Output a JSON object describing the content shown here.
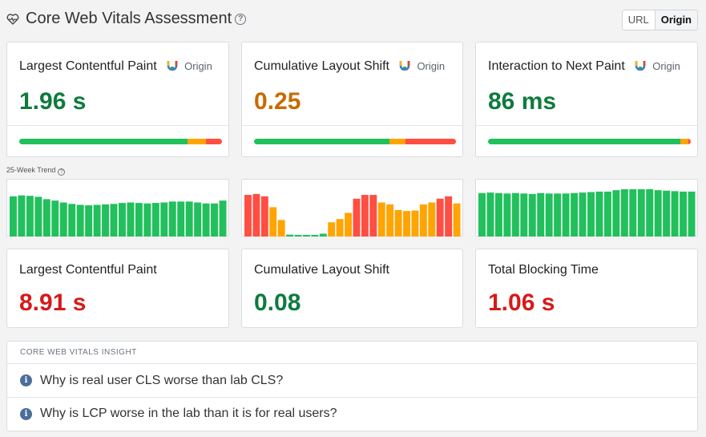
{
  "header": {
    "title": "Core Web Vitals Assessment",
    "toggle": {
      "url": "URL",
      "origin": "Origin",
      "active": "origin"
    }
  },
  "field_cards": [
    {
      "title": "Largest Contentful Paint",
      "badge": "Origin",
      "value": "1.96 s",
      "status": "good",
      "distribution": {
        "good": 0.83,
        "ni": 0.09,
        "poor": 0.08
      }
    },
    {
      "title": "Cumulative Layout Shift",
      "badge": "Origin",
      "value": "0.25",
      "status": "ni",
      "distribution": {
        "good": 0.67,
        "ni": 0.08,
        "poor": 0.25
      }
    },
    {
      "title": "Interaction to Next Paint",
      "badge": "Origin",
      "value": "86 ms",
      "status": "good",
      "distribution": {
        "good": 0.95,
        "ni": 0.04,
        "poor": 0.01
      }
    }
  ],
  "trend": {
    "label": "25-Week Trend",
    "series": [
      {
        "name": "",
        "values": [
          0.85,
          0.87,
          0.86,
          0.84,
          0.79,
          0.76,
          0.72,
          0.69,
          0.67,
          0.66,
          0.67,
          0.68,
          0.69,
          0.71,
          0.72,
          0.71,
          0.7,
          0.71,
          0.72,
          0.74,
          0.74,
          0.74,
          0.72,
          0.7,
          0.7,
          0.76
        ],
        "colors": [
          "good",
          "good",
          "good",
          "good",
          "good",
          "good",
          "good",
          "good",
          "good",
          "good",
          "good",
          "good",
          "good",
          "good",
          "good",
          "good",
          "good",
          "good",
          "good",
          "good",
          "good",
          "good",
          "good",
          "good",
          "good",
          "good"
        ]
      },
      {
        "name": "",
        "values": [
          0.88,
          0.9,
          0.85,
          0.62,
          0.35,
          0.04,
          0.03,
          0.03,
          0.03,
          0.06,
          0.3,
          0.37,
          0.5,
          0.8,
          0.88,
          0.88,
          0.72,
          0.68,
          0.56,
          0.54,
          0.55,
          0.68,
          0.72,
          0.8,
          0.85,
          0.7
        ],
        "colors": [
          "poor",
          "poor",
          "poor",
          "ni",
          "ni",
          "good",
          "good",
          "good",
          "good",
          "good",
          "ni",
          "ni",
          "ni",
          "poor",
          "poor",
          "poor",
          "ni",
          "ni",
          "ni",
          "ni",
          "ni",
          "ni",
          "ni",
          "poor",
          "poor",
          "ni"
        ]
      },
      {
        "name": "",
        "values": [
          0.92,
          0.93,
          0.92,
          0.91,
          0.92,
          0.91,
          0.9,
          0.92,
          0.91,
          0.91,
          0.91,
          0.92,
          0.93,
          0.94,
          0.95,
          0.95,
          0.98,
          1.0,
          1.0,
          1.0,
          1.0,
          0.98,
          0.97,
          0.96,
          0.95,
          0.95
        ],
        "colors": [
          "good",
          "good",
          "good",
          "good",
          "good",
          "good",
          "good",
          "good",
          "good",
          "good",
          "good",
          "good",
          "good",
          "good",
          "good",
          "good",
          "good",
          "good",
          "good",
          "good",
          "good",
          "good",
          "good",
          "good",
          "good",
          "good"
        ]
      }
    ],
    "palette": {
      "good": "#21c05c",
      "ni": "#ffa400",
      "poor": "#ff4e42"
    }
  },
  "lab_cards": [
    {
      "title": "Largest Contentful Paint",
      "value": "8.91 s",
      "status": "poor"
    },
    {
      "title": "Cumulative Layout Shift",
      "value": "0.08",
      "status": "good"
    },
    {
      "title": "Total Blocking Time",
      "value": "1.06 s",
      "status": "poor"
    }
  ],
  "insight": {
    "header": "CORE WEB VITALS INSIGHT",
    "items": [
      "Why is real user CLS worse than lab CLS?",
      "Why is LCP worse in the lab than it is for real users?"
    ]
  },
  "colors": {
    "good": "#0e7b3e",
    "ni": "#c96a00",
    "poor": "#d61a1a"
  }
}
